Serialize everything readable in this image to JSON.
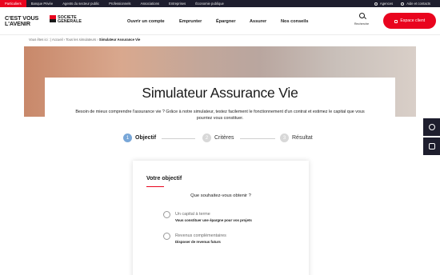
{
  "topbar": {
    "segments": [
      "Particuliers",
      "Banque Privée",
      "Agents du secteur public",
      "Professionnels",
      "Associations",
      "Entreprises",
      "Économie publique"
    ],
    "agences": "Agences",
    "aide": "Aide et contacts"
  },
  "header": {
    "tagline_line1": "C'EST VOUS",
    "tagline_line2": "L'AVENIR",
    "brand_line1": "SOCIETE",
    "brand_line2": "GENERALE",
    "nav": [
      "Ouvrir un compte",
      "Emprunter",
      "Épargner",
      "Assurer",
      "Nos conseils"
    ],
    "search_label": "Recherche",
    "espace_client": "Espace client"
  },
  "breadcrumb": {
    "prefix": "Vous êtes ici :",
    "items": [
      "Accueil",
      "Tous les simulateurs"
    ],
    "current": "Simulateur Assurance Vie"
  },
  "hero": {
    "title": "Simulateur Assurance Vie",
    "description": "Besoin de mieux comprendre l'assurance vie ? Grâce à notre simulateur, testez facilement le fonctionnement d'un contrat et estimez le capital que vous pourriez vous constituer."
  },
  "stepper": [
    {
      "num": "1",
      "label": "Objectif",
      "active": true
    },
    {
      "num": "2",
      "label": "Critères",
      "active": false
    },
    {
      "num": "3",
      "label": "Résultat",
      "active": false
    }
  ],
  "form": {
    "title": "Votre objectif",
    "question": "Que souhaitez-vous obtenir ?",
    "options": [
      {
        "label": "Un capital à terme",
        "sub": "Vous constituer une épargne pour vos projets"
      },
      {
        "label": "Revenus complémentaires",
        "sub": "Disposer de revenus futurs"
      }
    ]
  },
  "colors": {
    "brand_red": "#e9041e",
    "dark": "#1e1e2e",
    "step_active": "#79a7d8"
  },
  "side_widgets": [
    "chat-icon",
    "calendar-icon"
  ]
}
